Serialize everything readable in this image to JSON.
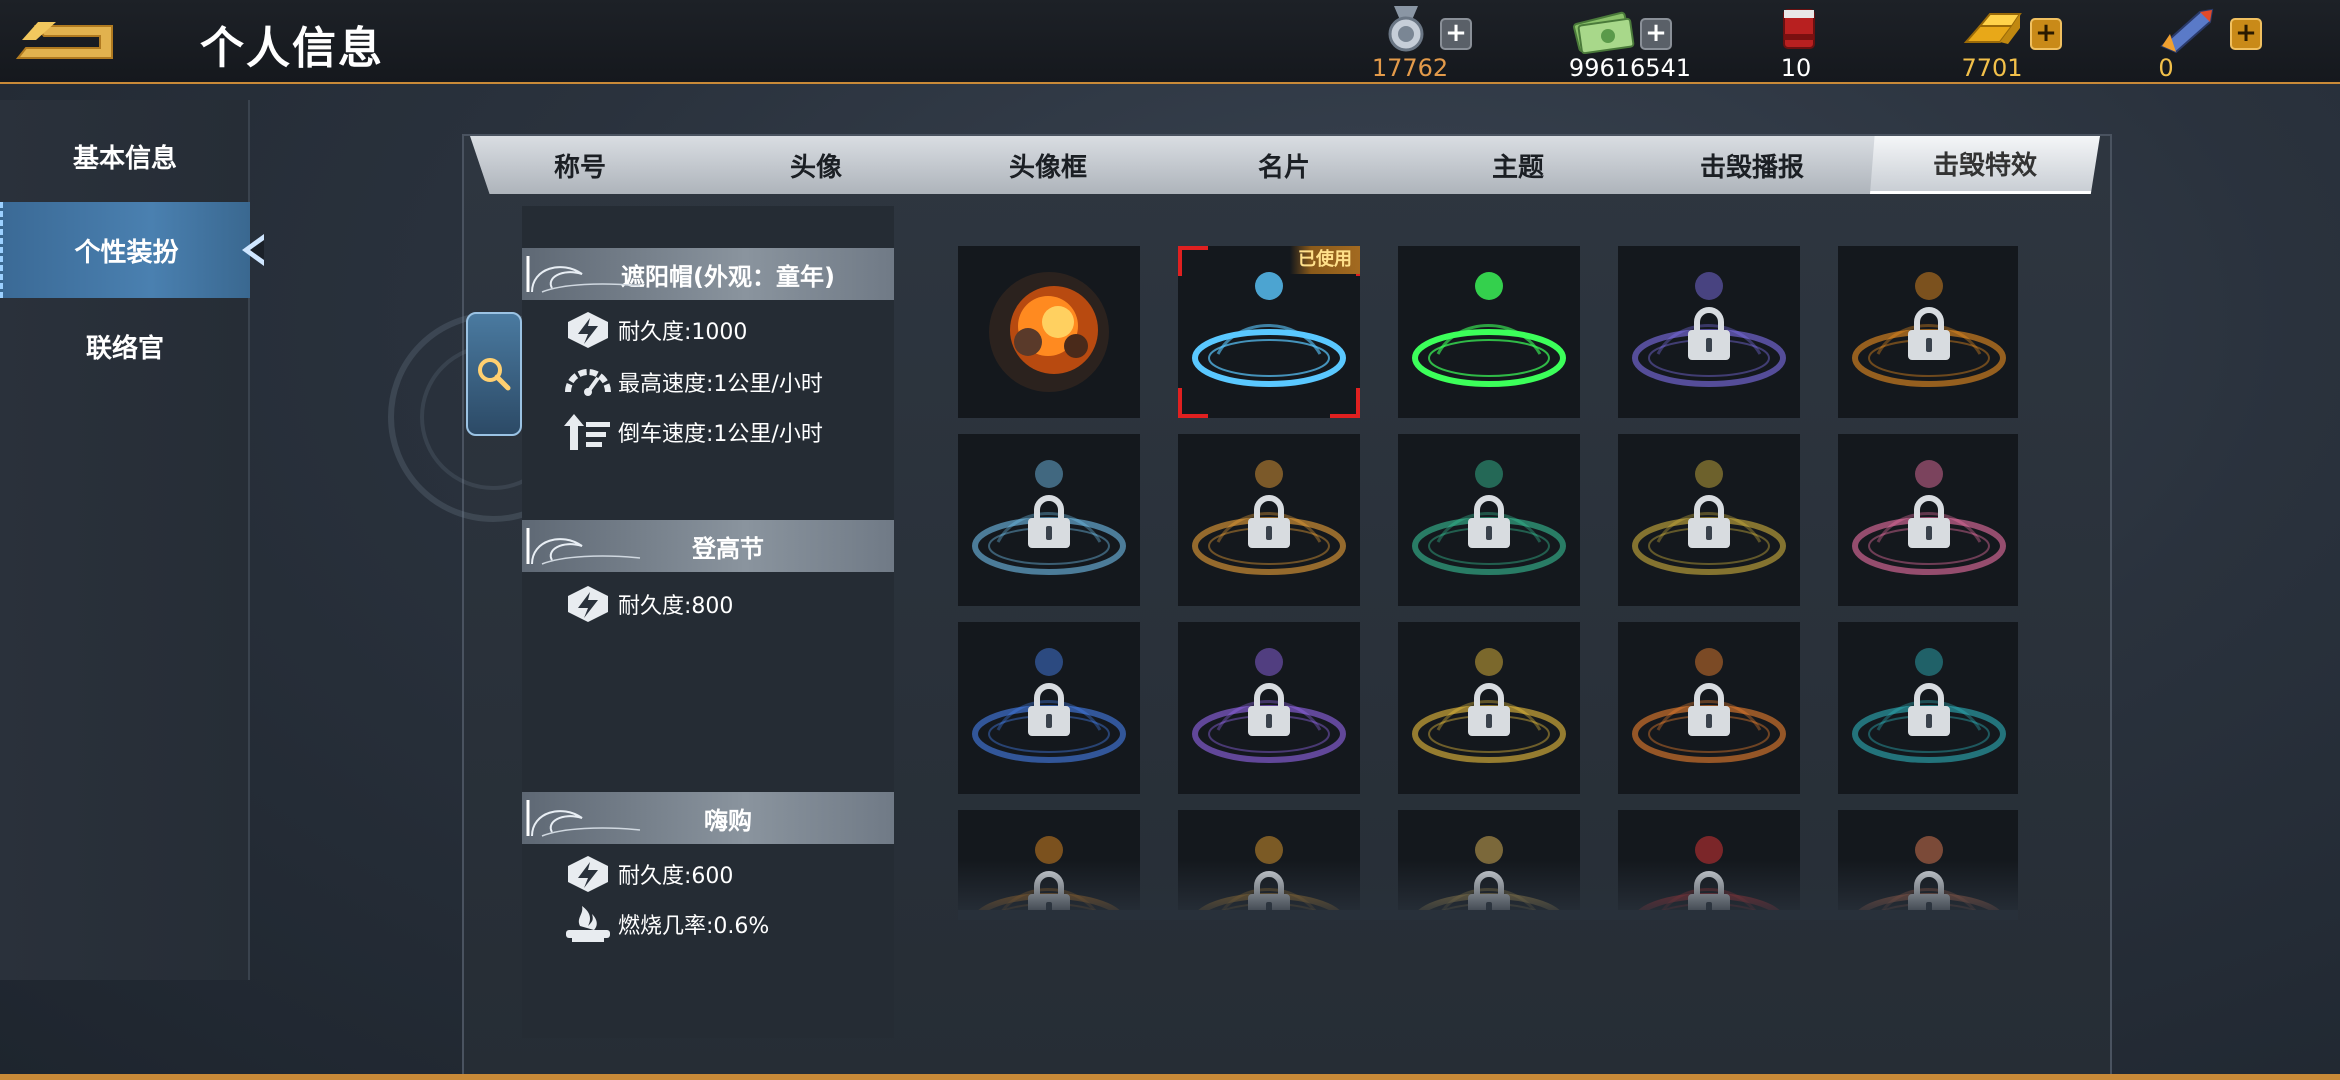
{
  "header": {
    "title": "个人信息",
    "back_icon": "back-arrow-icon",
    "accent": "#c98a38"
  },
  "currencies": [
    {
      "icon": "medal-icon",
      "value": "17762",
      "plus": "+"
    },
    {
      "icon": "cash-icon",
      "value": "99616541",
      "plus": "+"
    },
    {
      "icon": "paint-bucket-icon",
      "value": "10",
      "plus": ""
    },
    {
      "icon": "gold-bar-icon",
      "value": "7701",
      "plus": "+"
    },
    {
      "icon": "rocket-icon",
      "value": "0",
      "plus": "+"
    }
  ],
  "sidebar": {
    "items": [
      {
        "label": "基本信息",
        "active": false
      },
      {
        "label": "个性装扮",
        "active": true
      },
      {
        "label": "联络官",
        "active": false
      }
    ]
  },
  "tabs": [
    {
      "label": "称号",
      "active": false
    },
    {
      "label": "头像",
      "active": false
    },
    {
      "label": "头像框",
      "active": false
    },
    {
      "label": "名片",
      "active": false
    },
    {
      "label": "主题",
      "active": false
    },
    {
      "label": "击毁播报",
      "active": false
    },
    {
      "label": "击毁特效",
      "active": true
    }
  ],
  "info": {
    "sections": [
      {
        "title": "遮阳帽(外观：童年)",
        "stats": [
          {
            "icon": "durability-icon",
            "text": "耐久度:1000"
          },
          {
            "icon": "speedometer-icon",
            "text": "最高速度:1公里/小时"
          },
          {
            "icon": "reverse-speed-icon",
            "text": "倒车速度:1公里/小时"
          }
        ]
      },
      {
        "title": "登高节",
        "stats": [
          {
            "icon": "durability-icon",
            "text": "耐久度:800"
          }
        ]
      },
      {
        "title": "嗨购",
        "stats": [
          {
            "icon": "durability-icon",
            "text": "耐久度:600"
          },
          {
            "icon": "burn-icon",
            "text": "燃烧几率:0.6%"
          }
        ]
      }
    ]
  },
  "effects": {
    "used_label": "已使用",
    "items": [
      {
        "name": "explosion",
        "locked": false,
        "selected": false,
        "color": "#ff7a1a"
      },
      {
        "name": "blue-ice-ring",
        "locked": false,
        "selected": true,
        "color": "#5ac8ff"
      },
      {
        "name": "green-ring",
        "locked": false,
        "selected": false,
        "color": "#3cff5a"
      },
      {
        "name": "blue-purple-ring",
        "locked": true,
        "selected": false,
        "color": "#8a7aff"
      },
      {
        "name": "orange-ring",
        "locked": true,
        "selected": false,
        "color": "#ff9a20"
      },
      {
        "name": "snow-ring",
        "locked": true,
        "selected": false,
        "color": "#7ad0ff"
      },
      {
        "name": "gold-ring",
        "locked": true,
        "selected": false,
        "color": "#ffae3a"
      },
      {
        "name": "jade-ring",
        "locked": true,
        "selected": false,
        "color": "#3ad0a0"
      },
      {
        "name": "flower-ring",
        "locked": true,
        "selected": false,
        "color": "#e0c040"
      },
      {
        "name": "pink-ring",
        "locked": true,
        "selected": false,
        "color": "#ff7ab0"
      },
      {
        "name": "coin-ring",
        "locked": true,
        "selected": false,
        "color": "#4a8aff"
      },
      {
        "name": "violet-ring",
        "locked": true,
        "selected": false,
        "color": "#a070ff"
      },
      {
        "name": "sword-ring",
        "locked": true,
        "selected": false,
        "color": "#ffd040"
      },
      {
        "name": "red-gold-ring",
        "locked": true,
        "selected": false,
        "color": "#ff8a30"
      },
      {
        "name": "pumpkin-ring",
        "locked": true,
        "selected": false,
        "color": "#30c0c8"
      },
      {
        "name": "fire-arrows",
        "locked": true,
        "selected": false,
        "color": "#ff9a20"
      },
      {
        "name": "golden-crown",
        "locked": true,
        "selected": false,
        "color": "#ffb030"
      },
      {
        "name": "star-tree",
        "locked": true,
        "selected": false,
        "color": "#ffd060"
      },
      {
        "name": "lantern-ring",
        "locked": true,
        "selected": false,
        "color": "#ff3a3a"
      },
      {
        "name": "mascot-ring",
        "locked": true,
        "selected": false,
        "color": "#ff8a5a"
      }
    ]
  }
}
